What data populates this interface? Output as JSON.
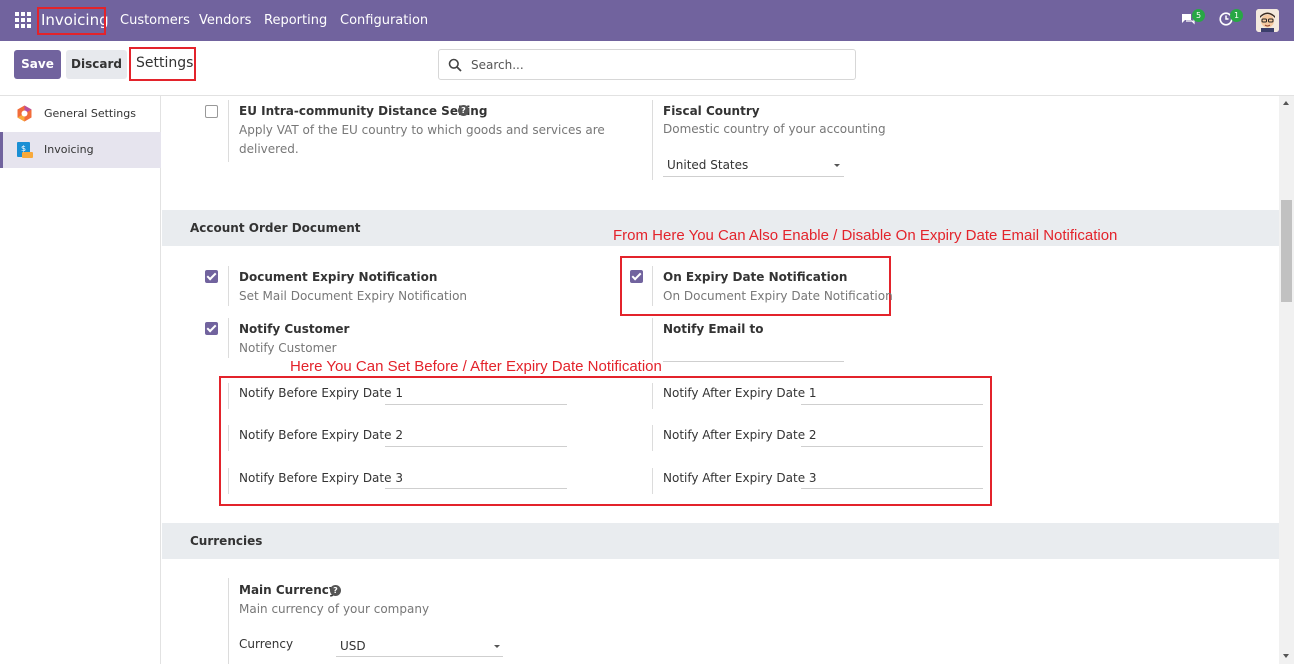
{
  "nav": {
    "brand": "Invoicing",
    "menu": [
      "Customers",
      "Vendors",
      "Reporting",
      "Configuration"
    ],
    "chat_count": "5",
    "activity_count": "1"
  },
  "control": {
    "save_label": "Save",
    "discard_label": "Discard",
    "title": "Settings",
    "search_placeholder": "Search..."
  },
  "sidebar": {
    "items": [
      {
        "label": "General Settings",
        "icon": "odoo-settings-icon"
      },
      {
        "label": "Invoicing",
        "icon": "invoicing-app-icon",
        "active": true
      }
    ]
  },
  "top_block": {
    "eu_label": "EU Intra-community Distance Selling",
    "eu_desc": "Apply VAT of the EU country to which goods and services are delivered.",
    "eu_checked": false,
    "fiscal_label": "Fiscal Country",
    "fiscal_desc": "Domestic country of your accounting",
    "fiscal_value": "United States"
  },
  "account_order": {
    "heading": "Account Order Document",
    "expiry_label": "Document Expiry Notification",
    "expiry_desc": "Set Mail Document Expiry Notification",
    "on_expiry_label": "On Expiry Date Notification",
    "on_expiry_desc": "On Document Expiry Date Notification",
    "notify_customer_label": "Notify Customer",
    "notify_customer_desc": "Notify Customer",
    "notify_email_label": "Notify Email to",
    "before": [
      "Notify Before Expiry Date 1",
      "Notify Before Expiry Date 2",
      "Notify Before Expiry Date 3"
    ],
    "after": [
      "Notify After Expiry Date 1",
      "Notify After Expiry Date 2",
      "Notify After Expiry Date 3"
    ]
  },
  "annotations": {
    "top": "From Here You Can Also Enable / Disable On Expiry Date Email Notification",
    "middle": "Here You Can Set Before / After Expiry Date Notification"
  },
  "currencies": {
    "heading": "Currencies",
    "main_label": "Main Currency",
    "main_desc": "Main currency of your company",
    "currency_label": "Currency",
    "currency_value": "USD"
  },
  "colors": {
    "brand": "#71639e",
    "annotation": "#e3232b"
  }
}
